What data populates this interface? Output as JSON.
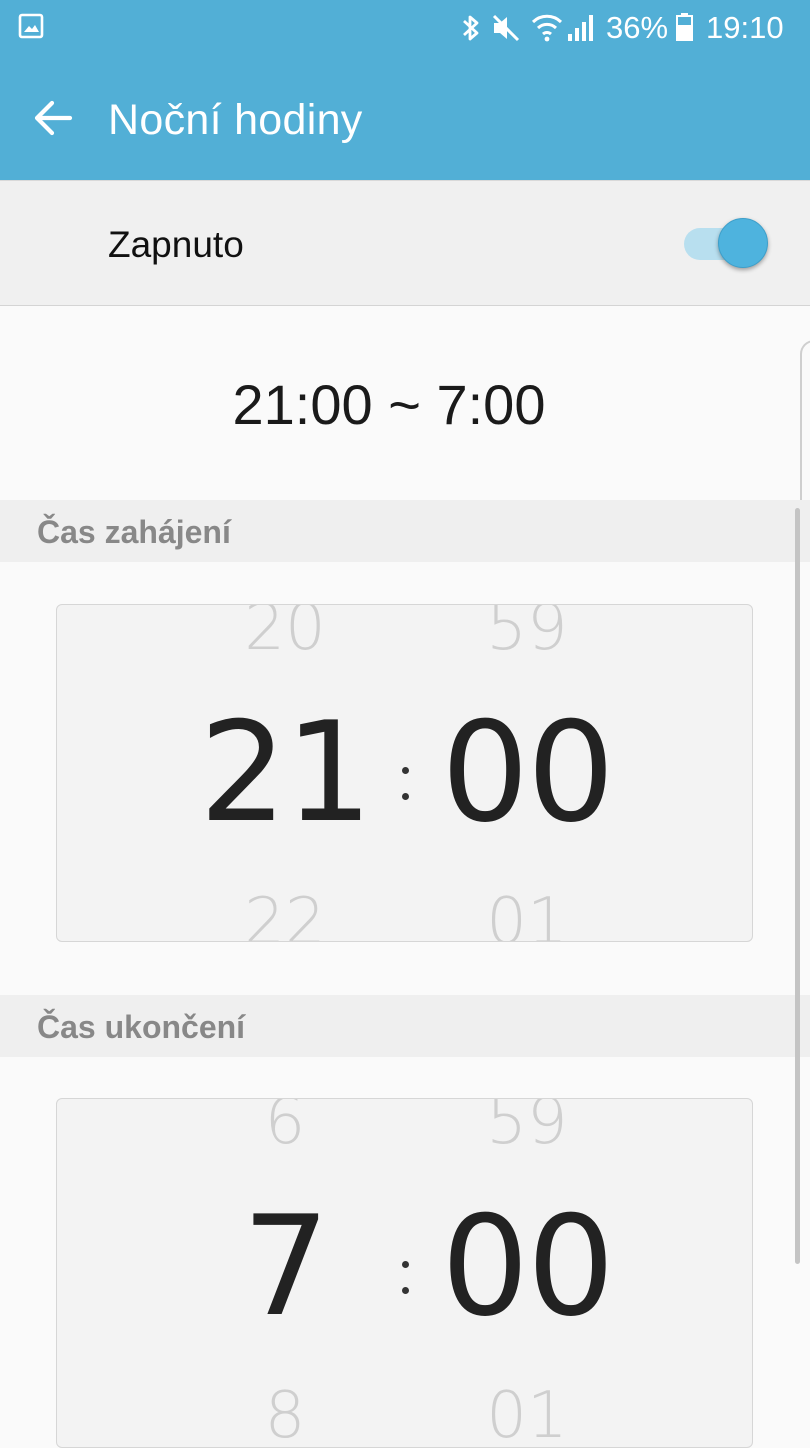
{
  "status_bar": {
    "battery_percent": "36%",
    "time": "19:10",
    "icons": [
      "gallery-notification-icon",
      "bluetooth-icon",
      "mute-icon",
      "wifi-icon",
      "signal-icon",
      "battery-icon"
    ]
  },
  "app_bar": {
    "title": "Noční hodiny",
    "back_icon": "arrow-left-icon"
  },
  "master_switch": {
    "label": "Zapnuto",
    "checked": true
  },
  "summary": "21:00 ~ 7:00",
  "start": {
    "header": "Čas zahájení",
    "hour_prev": "20",
    "hour": "21",
    "hour_next": "22",
    "separator": ":",
    "minute_prev": "59",
    "minute": "00",
    "minute_next": "01"
  },
  "end": {
    "header": "Čas ukončení",
    "hour_prev": "6",
    "hour": "7",
    "hour_next": "8",
    "separator": ":",
    "minute_prev": "59",
    "minute": "00",
    "minute_next": "01"
  },
  "colors": {
    "accent": "#52afd6",
    "switch_thumb": "#4eb3de",
    "switch_track": "#b8dfef"
  }
}
